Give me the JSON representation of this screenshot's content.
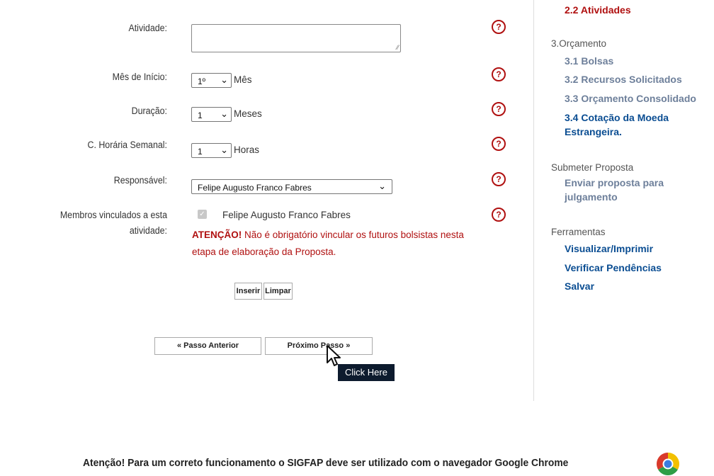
{
  "form": {
    "atividade_label": "Atividade:",
    "mes_inicio_label": "Mês de Início:",
    "mes_inicio_value": "1º",
    "mes_unit": "Mês",
    "duracao_label": "Duração:",
    "duracao_value": "1",
    "duracao_unit": "Meses",
    "carga_label": "C. Horária Semanal:",
    "carga_value": "1",
    "carga_unit": "Horas",
    "responsavel_label": "Responsável:",
    "responsavel_value": "Felipe Augusto Franco Fabres",
    "membros_label_1": "Membros vinculados a esta",
    "membros_label_2": "atividade:",
    "membro_name": "Felipe Augusto Franco Fabres",
    "aviso_bold": "ATENÇÃO!",
    "aviso_text_1": " Não é obrigatório vincular os futuros bolsistas nesta",
    "aviso_text_2": "etapa de elaboração da Proposta.",
    "inserir": "Inserir",
    "limpar": "Limpar",
    "help_glyph": "?"
  },
  "nav": {
    "prev": "« Passo Anterior",
    "next": "Próximo Passo »",
    "tooltip": "Click Here"
  },
  "sidebar": {
    "cut_item": "2.2 Atividades",
    "orcamento_heading": "3.Orçamento",
    "bolsas": "3.1 Bolsas",
    "recursos": "3.2 Recursos Solicitados",
    "consolidado": "3.3 Orçamento Consolidado",
    "cotacao_1": "3.4 Cotação da Moeda",
    "cotacao_2": "Estrangeira.",
    "submeter_heading": "Submeter Proposta",
    "enviar_1": "Enviar proposta para",
    "enviar_2": "julgamento",
    "ferramentas_heading": "Ferramentas",
    "visualizar": "Visualizar/Imprimir",
    "verificar": "Verificar Pendências",
    "salvar": "Salvar"
  },
  "footer": {
    "notice": "Atenção! Para um correto funcionamento o SIGFAP deve ser utilizado com o navegador Google Chrome"
  },
  "colors": {
    "red": "#b01010",
    "blue": "#0a4d92",
    "gray_link": "#6d7f9a",
    "tooltip_bg": "#0d1b2e"
  }
}
